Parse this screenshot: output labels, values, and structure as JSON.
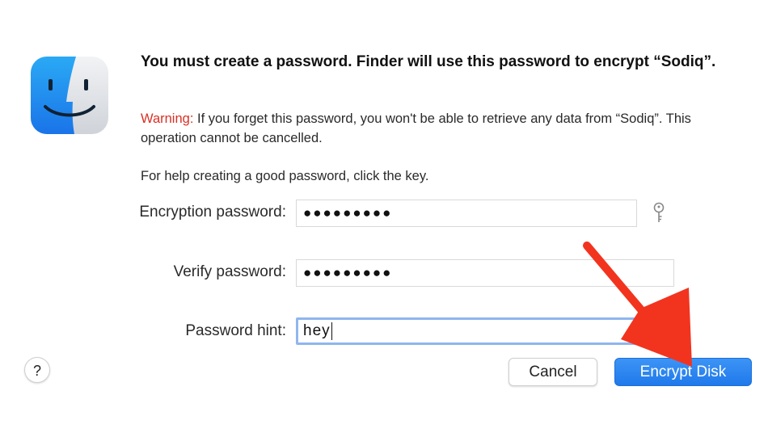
{
  "dialog": {
    "title": "You must create a password. Finder will use this password to encrypt “Sodiq”.",
    "warning_label": "Warning:",
    "warning_text": " If you forget this password, you won't be able to retrieve any data from “Sodiq”. This operation cannot be cancelled.",
    "help_text": "For help creating a good password, click the key."
  },
  "fields": {
    "encryption_label": "Encryption password:",
    "encryption_value": "●●●●●●●●●",
    "verify_label": "Verify password:",
    "verify_value": "●●●●●●●●●",
    "hint_label": "Password hint:",
    "hint_value": "hey"
  },
  "buttons": {
    "help_label": "?",
    "cancel_label": "Cancel",
    "encrypt_label": "Encrypt Disk"
  },
  "icons": {
    "app_icon": "finder-icon",
    "password_assistant": "key-icon",
    "annotation": "red-arrow"
  },
  "colors": {
    "warning": "#d93025",
    "primary_button": "#1f79ea",
    "focus_ring": "#8fb6ef",
    "annotation_arrow": "#f2341f"
  }
}
